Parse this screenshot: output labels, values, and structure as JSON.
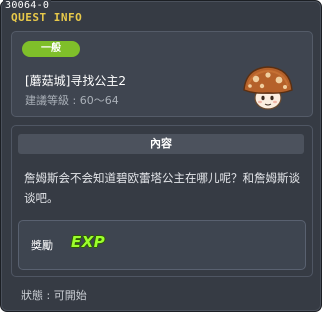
{
  "window": {
    "quest_id": "30064-0",
    "title": "QUEST INFO"
  },
  "quest": {
    "category": "一般",
    "name": "[蘑菇城]寻找公主2",
    "level_range": "建議等級 : 60～64",
    "npc_icon": "mushroom-npc-icon"
  },
  "details": {
    "section_title": "內容",
    "description": "詹姆斯会不会知道碧欧蕾塔公主在哪儿呢？和詹姆斯谈谈吧。"
  },
  "reward": {
    "label": "獎勵",
    "exp_text": "EXP",
    "exp_icon": "exp-icon"
  },
  "status": {
    "text": "狀態 : 可開始"
  },
  "colors": {
    "background": "#363b44",
    "title": "#e8c94a",
    "badge": "#7fbf2a",
    "exp": "#9cff2c"
  }
}
